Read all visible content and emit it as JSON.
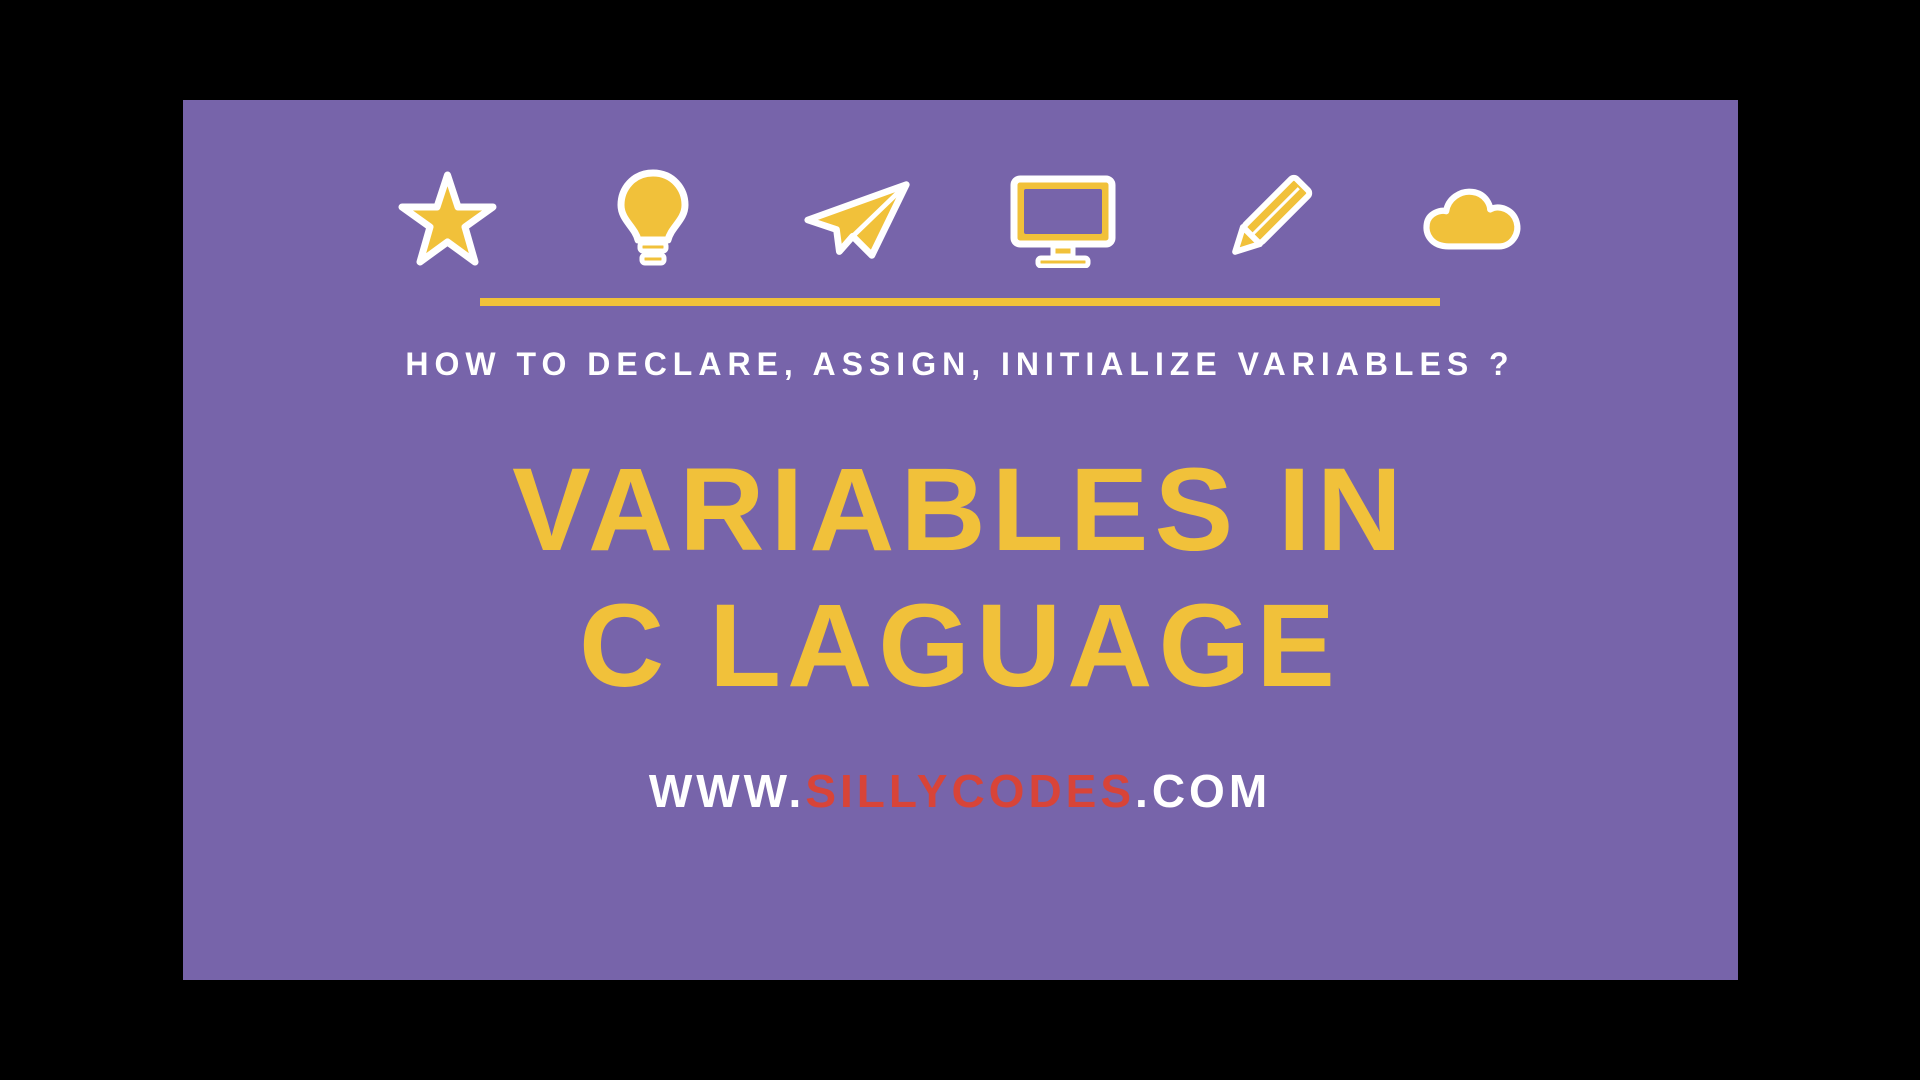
{
  "colors": {
    "background": "#7764aa",
    "accent": "#f1c13a",
    "text_light": "#ffffff",
    "brand_red": "#d84438"
  },
  "subtitle": "HOW TO DECLARE, ASSIGN, INITIALIZE VARIABLES ?",
  "title_line1": "VARIABLES IN",
  "title_line2": "C  LAGUAGE",
  "url": {
    "prefix": "WWW.",
    "brand": "SILLYCODES",
    "suffix": ".COM"
  },
  "icons": [
    "star-icon",
    "lightbulb-icon",
    "paper-plane-icon",
    "monitor-icon",
    "pencil-icon",
    "cloud-icon"
  ]
}
